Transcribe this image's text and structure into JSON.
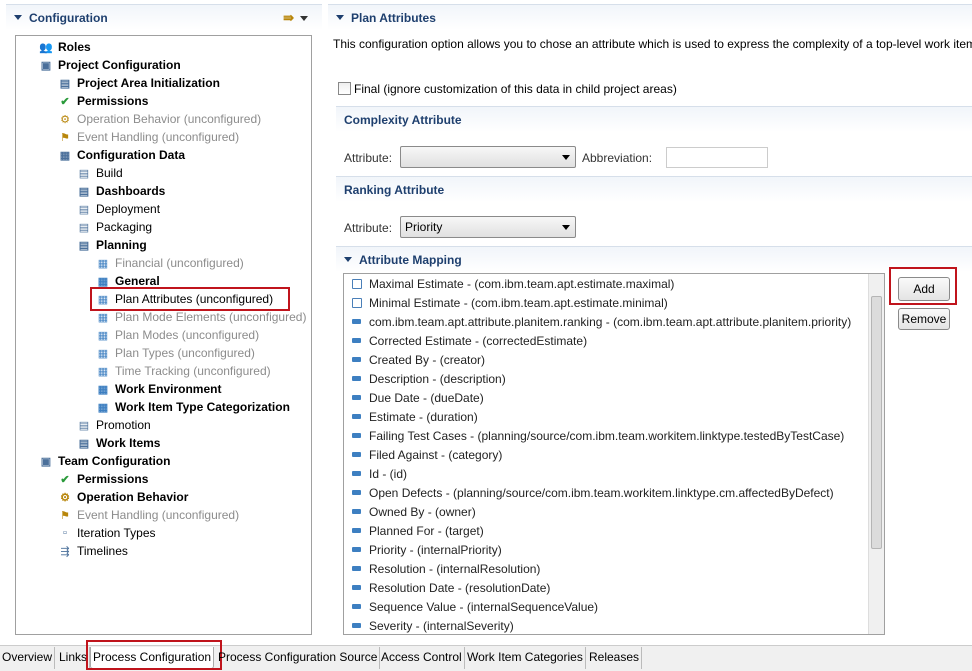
{
  "left": {
    "title": "Configuration",
    "tree": [
      {
        "label": "Roles",
        "level": 0,
        "style": "bold",
        "icon": "roles-icon"
      },
      {
        "label": "Project Configuration",
        "level": 0,
        "style": "bold",
        "icon": "project-config-icon"
      },
      {
        "label": "Project Area Initialization",
        "level": 1,
        "style": "bold",
        "icon": "initialization-icon"
      },
      {
        "label": "Permissions",
        "level": 1,
        "style": "bold",
        "icon": "permissions-icon"
      },
      {
        "label": "Operation Behavior (unconfigured)",
        "level": 1,
        "style": "gray",
        "icon": "gears-icon"
      },
      {
        "label": "Event Handling (unconfigured)",
        "level": 1,
        "style": "gray",
        "icon": "event-icon"
      },
      {
        "label": "Configuration Data",
        "level": 1,
        "style": "bold",
        "icon": "config-data-icon"
      },
      {
        "label": "Build",
        "level": 2,
        "style": "normal",
        "icon": "data-item-icon"
      },
      {
        "label": "Dashboards",
        "level": 2,
        "style": "bold",
        "icon": "data-item-icon"
      },
      {
        "label": "Deployment",
        "level": 2,
        "style": "normal",
        "icon": "data-item-icon"
      },
      {
        "label": "Packaging",
        "level": 2,
        "style": "normal",
        "icon": "data-item-icon"
      },
      {
        "label": "Planning",
        "level": 2,
        "style": "bold",
        "icon": "data-item-icon"
      },
      {
        "label": "Financial (unconfigured)",
        "level": 3,
        "style": "gray",
        "icon": "plan-item-icon"
      },
      {
        "label": "General",
        "level": 3,
        "style": "bold",
        "icon": "plan-item-icon"
      },
      {
        "label": "Plan Attributes (unconfigured)",
        "level": 3,
        "style": "normal",
        "icon": "plan-item-icon",
        "selected": true
      },
      {
        "label": "Plan Mode Elements (unconfigured)",
        "level": 3,
        "style": "gray",
        "icon": "plan-item-icon"
      },
      {
        "label": "Plan Modes (unconfigured)",
        "level": 3,
        "style": "gray",
        "icon": "plan-item-icon"
      },
      {
        "label": "Plan Types (unconfigured)",
        "level": 3,
        "style": "gray",
        "icon": "plan-item-icon"
      },
      {
        "label": "Time Tracking (unconfigured)",
        "level": 3,
        "style": "gray",
        "icon": "plan-item-icon"
      },
      {
        "label": "Work Environment",
        "level": 3,
        "style": "bold",
        "icon": "plan-item-icon"
      },
      {
        "label": "Work Item Type Categorization",
        "level": 3,
        "style": "bold",
        "icon": "plan-item-icon"
      },
      {
        "label": "Promotion",
        "level": 2,
        "style": "normal",
        "icon": "data-item-icon"
      },
      {
        "label": "Work Items",
        "level": 2,
        "style": "bold",
        "icon": "data-item-icon"
      },
      {
        "label": "Team Configuration",
        "level": 0,
        "style": "bold",
        "icon": "team-config-icon"
      },
      {
        "label": "Permissions",
        "level": 1,
        "style": "bold",
        "icon": "permissions-icon"
      },
      {
        "label": "Operation Behavior",
        "level": 1,
        "style": "bold",
        "icon": "gears-icon"
      },
      {
        "label": "Event Handling (unconfigured)",
        "level": 1,
        "style": "gray",
        "icon": "event-icon"
      },
      {
        "label": "Iteration Types",
        "level": 1,
        "style": "normal",
        "icon": "iteration-icon"
      },
      {
        "label": "Timelines",
        "level": 1,
        "style": "normal",
        "icon": "timeline-icon"
      }
    ]
  },
  "right": {
    "title": "Plan Attributes",
    "description": "This configuration option allows you to chose an attribute which is used to express the complexity of a top-level work item",
    "final_label": "Final (ignore customization of this data in child project areas)",
    "final_checked": false,
    "complexity": {
      "title": "Complexity Attribute",
      "attr_label": "Attribute:",
      "attr_value": "",
      "abbr_label": "Abbreviation:",
      "abbr_value": ""
    },
    "ranking": {
      "title": "Ranking Attribute",
      "attr_label": "Attribute:",
      "attr_value": "Priority"
    },
    "mapping": {
      "title": "Attribute Mapping",
      "add_label": "Add",
      "remove_label": "Remove",
      "items": [
        {
          "label": "Maximal Estimate - (com.ibm.team.apt.estimate.maximal)",
          "icon": "edit-icon"
        },
        {
          "label": "Minimal Estimate - (com.ibm.team.apt.estimate.minimal)",
          "icon": "edit-icon"
        },
        {
          "label": "com.ibm.team.apt.attribute.planitem.ranking - (com.ibm.team.apt.attribute.planitem.priority)",
          "icon": "attribute-icon"
        },
        {
          "label": "Corrected Estimate - (correctedEstimate)",
          "icon": "attribute-icon"
        },
        {
          "label": "Created By - (creator)",
          "icon": "attribute-icon"
        },
        {
          "label": "Description - (description)",
          "icon": "attribute-icon"
        },
        {
          "label": "Due Date - (dueDate)",
          "icon": "attribute-icon"
        },
        {
          "label": "Estimate - (duration)",
          "icon": "attribute-icon"
        },
        {
          "label": "Failing Test Cases - (planning/source/com.ibm.team.workitem.linktype.testedByTestCase)",
          "icon": "attribute-icon"
        },
        {
          "label": "Filed Against - (category)",
          "icon": "attribute-icon"
        },
        {
          "label": "Id - (id)",
          "icon": "attribute-icon"
        },
        {
          "label": "Open Defects - (planning/source/com.ibm.team.workitem.linktype.cm.affectedByDefect)",
          "icon": "attribute-icon"
        },
        {
          "label": "Owned By - (owner)",
          "icon": "attribute-icon"
        },
        {
          "label": "Planned For - (target)",
          "icon": "attribute-icon"
        },
        {
          "label": "Priority - (internalPriority)",
          "icon": "attribute-icon"
        },
        {
          "label": "Resolution - (internalResolution)",
          "icon": "attribute-icon"
        },
        {
          "label": "Resolution Date - (resolutionDate)",
          "icon": "attribute-icon"
        },
        {
          "label": "Sequence Value - (internalSequenceValue)",
          "icon": "attribute-icon"
        },
        {
          "label": "Severity - (internalSeverity)",
          "icon": "attribute-icon"
        }
      ]
    }
  },
  "tabs": [
    {
      "label": "Overview"
    },
    {
      "label": "Links"
    },
    {
      "label": "Process Configuration",
      "active": true
    },
    {
      "label": "Process Configuration Source"
    },
    {
      "label": "Access Control"
    },
    {
      "label": "Work Item Categories"
    },
    {
      "label": "Releases"
    }
  ],
  "colors": {
    "highlight": "#c0141c",
    "section_title": "#1e3f6e"
  }
}
